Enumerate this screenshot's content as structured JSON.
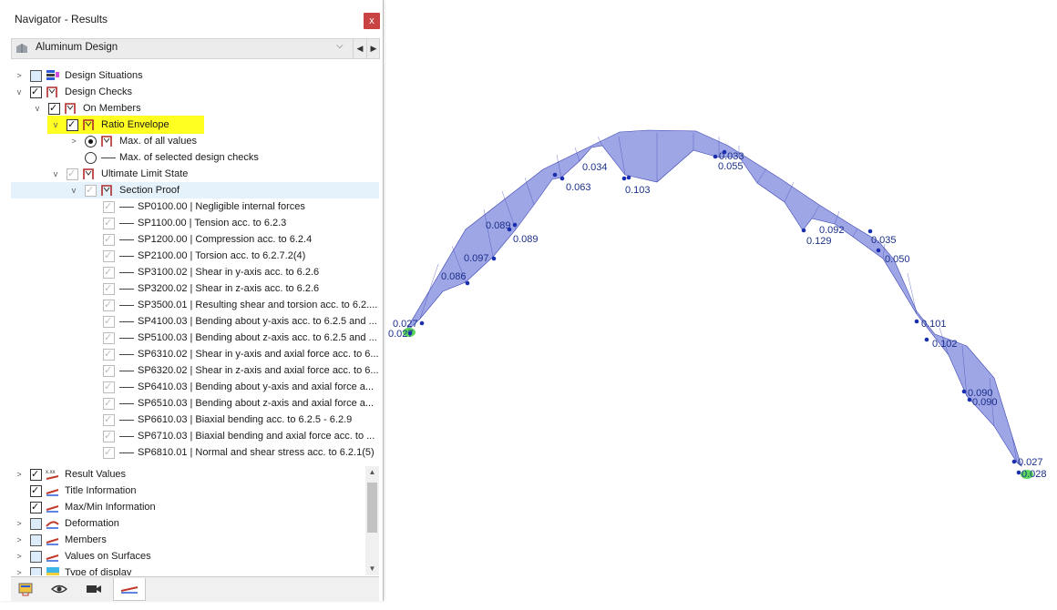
{
  "panel": {
    "title": "Navigator - Results",
    "close_glyph": "x",
    "dropdown_value": "Aluminum Design"
  },
  "tree": {
    "design_situations": "Design Situations",
    "design_checks": "Design Checks",
    "on_members": "On Members",
    "ratio_envelope": "Ratio Envelope",
    "max_all": "Max. of all values",
    "max_selected": "Max. of selected design checks",
    "uls": "Ultimate Limit State",
    "section_proof": "Section Proof",
    "proofs": [
      "SP0100.00 | Negligible internal forces",
      "SP1100.00 | Tension acc. to 6.2.3",
      "SP1200.00 | Compression acc. to 6.2.4",
      "SP2100.00 | Torsion acc. to 6.2.7.2(4)",
      "SP3100.02 | Shear in y-axis acc. to 6.2.6",
      "SP3200.02 | Shear in z-axis acc. to 6.2.6",
      "SP3500.01 | Resulting shear and torsion acc. to 6.2....",
      "SP4100.03 | Bending about y-axis acc. to 6.2.5 and ...",
      "SP5100.03 | Bending about z-axis acc. to 6.2.5 and ...",
      "SP6310.02 | Shear in y-axis and axial force acc. to 6....",
      "SP6320.02 | Shear in z-axis and axial force acc. to 6....",
      "SP6410.03 | Bending about y-axis and axial force a...",
      "SP6510.03 | Bending about z-axis and axial force a...",
      "SP6610.03 | Biaxial bending acc. to 6.2.5 - 6.2.9",
      "SP6710.03 | Biaxial bending and axial force acc. to ...",
      "SP6810.01 | Normal and shear stress acc. to 6.2.1(5)"
    ]
  },
  "display": {
    "result_values": "Result Values",
    "title_information": "Title Information",
    "maxmin_information": "Max/Min Information",
    "deformation": "Deformation",
    "members": "Members",
    "values_on_surfaces": "Values on Surfaces",
    "type_of_display": "Type of display"
  },
  "model_labels": [
    "0.027",
    "0.027",
    "0.086",
    "0.097",
    "0.089",
    "0.089",
    "0.063",
    "0.034",
    "0.103",
    "0.033",
    "0.055",
    "0.092",
    "0.129",
    "0.035",
    "0.050",
    "0.101",
    "0.102",
    "0.090",
    "0.090",
    "0.027",
    "0.028"
  ],
  "colors": {
    "accent_highlight": "#ffff22",
    "diagram_fill": "#8e96e0",
    "diagram_stroke": "#3b45b4",
    "label_color": "#1a2f8a",
    "support_green": "#5cd65c",
    "close_red": "#c84341"
  }
}
